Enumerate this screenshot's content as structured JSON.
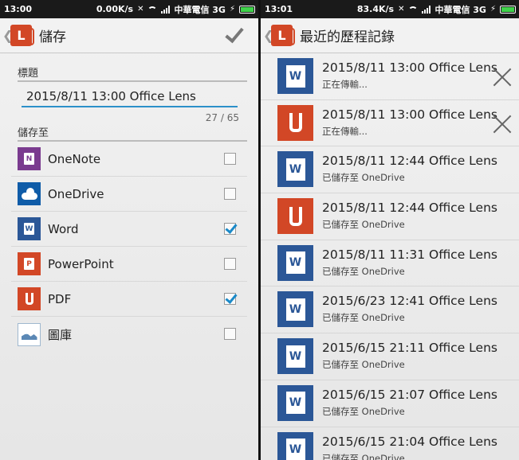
{
  "left": {
    "status": {
      "time": "13:00",
      "speed": "0.00K/s",
      "carrier": "中華電信 3G"
    },
    "appbar": {
      "logo": "L",
      "title": "儲存",
      "back_glyph": "❮"
    },
    "title_label": "標題",
    "title_value": "2015/8/11 13:00 Office Lens",
    "counter": "27 / 65",
    "save_to_label": "儲存至",
    "destinations": [
      {
        "label": "OneNote",
        "checked": false,
        "icon": "onenote-icon",
        "mark": "N"
      },
      {
        "label": "OneDrive",
        "checked": false,
        "icon": "onedrive-icon",
        "mark": ""
      },
      {
        "label": "Word",
        "checked": true,
        "icon": "word-icon",
        "mark": "W"
      },
      {
        "label": "PowerPoint",
        "checked": false,
        "icon": "powerpoint-icon",
        "mark": "P"
      },
      {
        "label": "PDF",
        "checked": true,
        "icon": "pdf-icon",
        "mark": ""
      },
      {
        "label": "圖庫",
        "checked": false,
        "icon": "gallery-icon",
        "mark": ""
      }
    ]
  },
  "right": {
    "status": {
      "time": "13:01",
      "speed": "83.4K/s",
      "carrier": "中華電信 3G"
    },
    "appbar": {
      "logo": "L",
      "title": "最近的歷程記錄",
      "back_glyph": "❮"
    },
    "history": [
      {
        "title": "2015/8/11 13:00 Office Lens",
        "status": "正在傳輸...",
        "type": "word",
        "cancel": true
      },
      {
        "title": "2015/8/11 13:00 Office Lens",
        "status": "正在傳輸...",
        "type": "pdf",
        "cancel": true
      },
      {
        "title": "2015/8/11 12:44 Office Lens",
        "status": "已儲存至 OneDrive",
        "type": "word",
        "cancel": false
      },
      {
        "title": "2015/8/11 12:44 Office Lens",
        "status": "已儲存至 OneDrive",
        "type": "pdf",
        "cancel": false
      },
      {
        "title": "2015/8/11 11:31 Office Lens",
        "status": "已儲存至 OneDrive",
        "type": "word",
        "cancel": false
      },
      {
        "title": "2015/6/23 12:41 Office Lens",
        "status": "已儲存至 OneDrive",
        "type": "word",
        "cancel": false
      },
      {
        "title": "2015/6/15 21:11 Office Lens",
        "status": "已儲存至 OneDrive",
        "type": "word",
        "cancel": false
      },
      {
        "title": "2015/6/15 21:07 Office Lens",
        "status": "已儲存至 OneDrive",
        "type": "word",
        "cancel": false
      },
      {
        "title": "2015/6/15 21:04 Office Lens",
        "status": "已儲存至 OneDrive",
        "type": "word",
        "cancel": false
      }
    ]
  },
  "colors": {
    "accent": "#2c90c9",
    "word": "#2b5797",
    "lens": "#d24726",
    "onenote": "#7a3b8f",
    "onedrive": "#0f5ca8"
  }
}
